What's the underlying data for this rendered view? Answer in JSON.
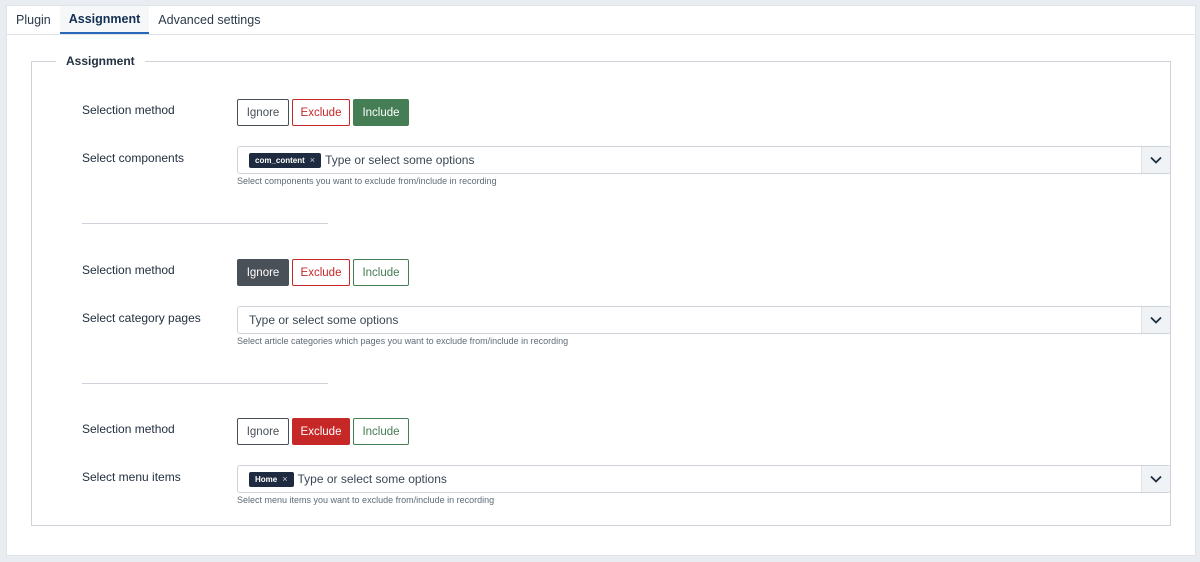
{
  "tabs": [
    {
      "label": "Plugin",
      "active": false
    },
    {
      "label": "Assignment",
      "active": true
    },
    {
      "label": "Advanced settings",
      "active": false
    }
  ],
  "fieldset": {
    "legend": "Assignment"
  },
  "sections": [
    {
      "method_label": "Selection method",
      "buttons": {
        "ignore": "Ignore",
        "exclude": "Exclude",
        "include": "Include"
      },
      "selected": "include",
      "select_label": "Select components",
      "chips": [
        "com_content"
      ],
      "placeholder": "Type or select some options",
      "hint": "Select components you want to exclude from/include in recording"
    },
    {
      "method_label": "Selection method",
      "buttons": {
        "ignore": "Ignore",
        "exclude": "Exclude",
        "include": "Include"
      },
      "selected": "ignore",
      "select_label": "Select category pages",
      "chips": [],
      "placeholder": "Type or select some options",
      "hint": "Select article categories which pages you want to exclude from/include in recording"
    },
    {
      "method_label": "Selection method",
      "buttons": {
        "ignore": "Ignore",
        "exclude": "Exclude",
        "include": "Include"
      },
      "selected": "exclude",
      "select_label": "Select menu items",
      "chips": [
        "Home"
      ],
      "placeholder": "Type or select some options",
      "hint": "Select menu items you want to exclude from/include in recording"
    }
  ],
  "chip_remove_symbol": "×",
  "colors": {
    "ignore": "#495057",
    "exclude": "#c52827",
    "include": "#457d54",
    "chip": "#1e2a3f",
    "active_tab_underline": "#2a69b8"
  },
  "icons": {
    "dropdown": "chevron-down-icon",
    "chip_remove": "close-icon"
  }
}
